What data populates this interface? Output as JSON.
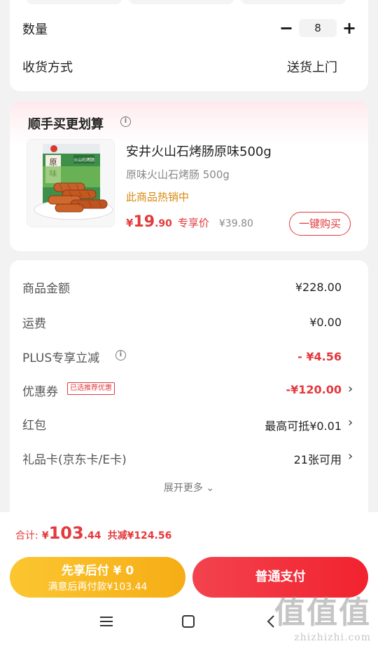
{
  "order": {
    "quantity_label": "数量",
    "quantity_minus": "−",
    "quantity_value": "8",
    "quantity_plus": "+",
    "delivery_label": "收货方式",
    "delivery_value": "送货上门"
  },
  "recommend": {
    "title": "顺手买更划算",
    "info_glyph": "i",
    "product": {
      "name": "安井火山石烤肠原味500g",
      "spec": "原味火山石烤肠 500g",
      "hot_text": "此商品热销中",
      "price_symbol": "¥",
      "price_int": "19",
      "price_dec": ".90",
      "price_tag": "专享价",
      "original_price": "¥39.80",
      "buy_button": "一键购买",
      "package_text_1": "原",
      "package_text_2": "味",
      "package_text_3": "火山石烤肠"
    }
  },
  "summary": {
    "rows": [
      {
        "label": "商品金额",
        "value": "¥228.00"
      },
      {
        "label": "运费",
        "value": "¥0.00"
      },
      {
        "label": "PLUS专享立减",
        "value": "- ¥4.56"
      },
      {
        "label": "优惠券",
        "tag": "已选推荐优惠",
        "value": "-¥120.00"
      },
      {
        "label": "红包",
        "value": "最高可抵¥0.01"
      },
      {
        "label": "礼品卡(京东卡/E卡)",
        "value": "21张可用"
      }
    ],
    "expand": "展开更多",
    "chevron": "›",
    "expand_chevron": "⌄"
  },
  "bottom": {
    "total_label": "合计:",
    "total_symbol": "¥",
    "total_int": "103",
    "total_dec": ".44",
    "total_save": "共减¥124.56",
    "pay_later_main": "先享后付 ¥ 0",
    "pay_later_sub": "满意后再付款¥103.44",
    "pay_button": "普通支付"
  },
  "watermark": {
    "big": "值值值",
    "small": "zhizhizhi.com"
  },
  "colors": {
    "accent_red": "#e4393c",
    "hot_orange": "#d88a10",
    "pay_later_yellow": "#f6ad15"
  }
}
